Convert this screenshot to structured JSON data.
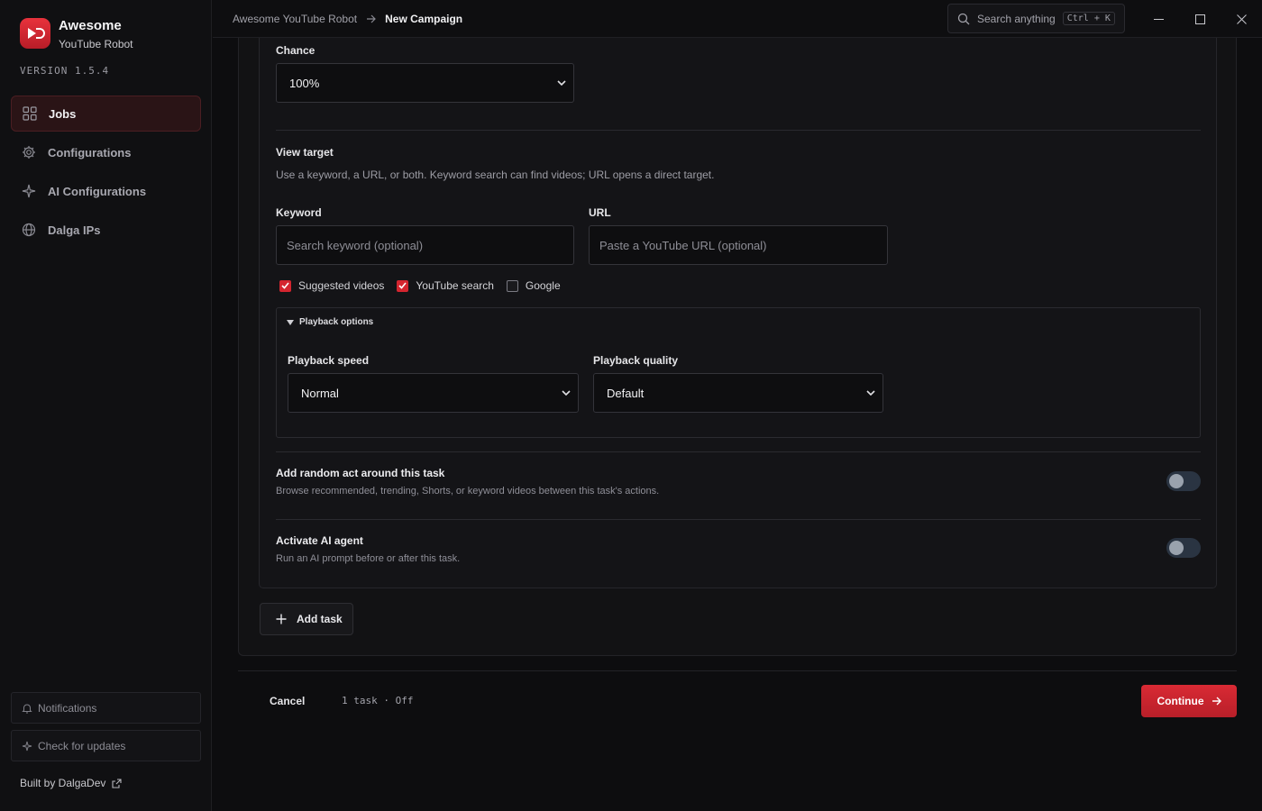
{
  "app": {
    "title": "Awesome",
    "subtitle": "YouTube Robot",
    "version": "VERSION 1.5.4"
  },
  "sidebar": {
    "items": [
      {
        "label": "Jobs",
        "icon": "grid-icon",
        "active": true
      },
      {
        "label": "Configurations",
        "icon": "gear-icon",
        "active": false
      },
      {
        "label": "AI Configurations",
        "icon": "sparkle-icon",
        "active": false
      },
      {
        "label": "Dalga IPs",
        "icon": "globe-icon",
        "active": false
      }
    ],
    "notifications_label": "Notifications",
    "check_updates_label": "Check for updates",
    "built_by": "Built by DalgaDev"
  },
  "header": {
    "breadcrumb_root": "Awesome YouTube Robot",
    "breadcrumb_current": "New Campaign",
    "search_placeholder": "Search anything",
    "search_shortcut": "Ctrl + K"
  },
  "task": {
    "chance_label": "Chance",
    "chance_value": "100%",
    "view_target_title": "View target",
    "view_target_hint": "Use a keyword, a URL, or both. Keyword search can find videos; URL opens a direct target.",
    "keyword_label": "Keyword",
    "keyword_placeholder": "Search keyword (optional)",
    "url_label": "URL",
    "url_placeholder": "Paste a YouTube URL (optional)",
    "sources": [
      {
        "label": "Suggested videos",
        "checked": true
      },
      {
        "label": "YouTube search",
        "checked": true
      },
      {
        "label": "Google",
        "checked": false
      }
    ],
    "playback": {
      "heading": "Playback options",
      "speed_label": "Playback speed",
      "speed_value": "Normal",
      "quality_label": "Playback quality",
      "quality_value": "Default"
    },
    "random_act": {
      "title": "Add random act around this task",
      "description": "Browse recommended, trending, Shorts, or keyword videos between this task's actions.",
      "enabled": false
    },
    "ai_agent": {
      "title": "Activate AI agent",
      "description": "Run an AI prompt before or after this task.",
      "enabled": false
    }
  },
  "actions": {
    "add_task_label": "Add task",
    "cancel_label": "Cancel",
    "summary": "1 task · Off",
    "continue_label": "Continue"
  },
  "colors": {
    "accent": "#d4252f",
    "background": "#0d0d0f",
    "panel": "#141417",
    "toggle_off": "#2a3442"
  }
}
